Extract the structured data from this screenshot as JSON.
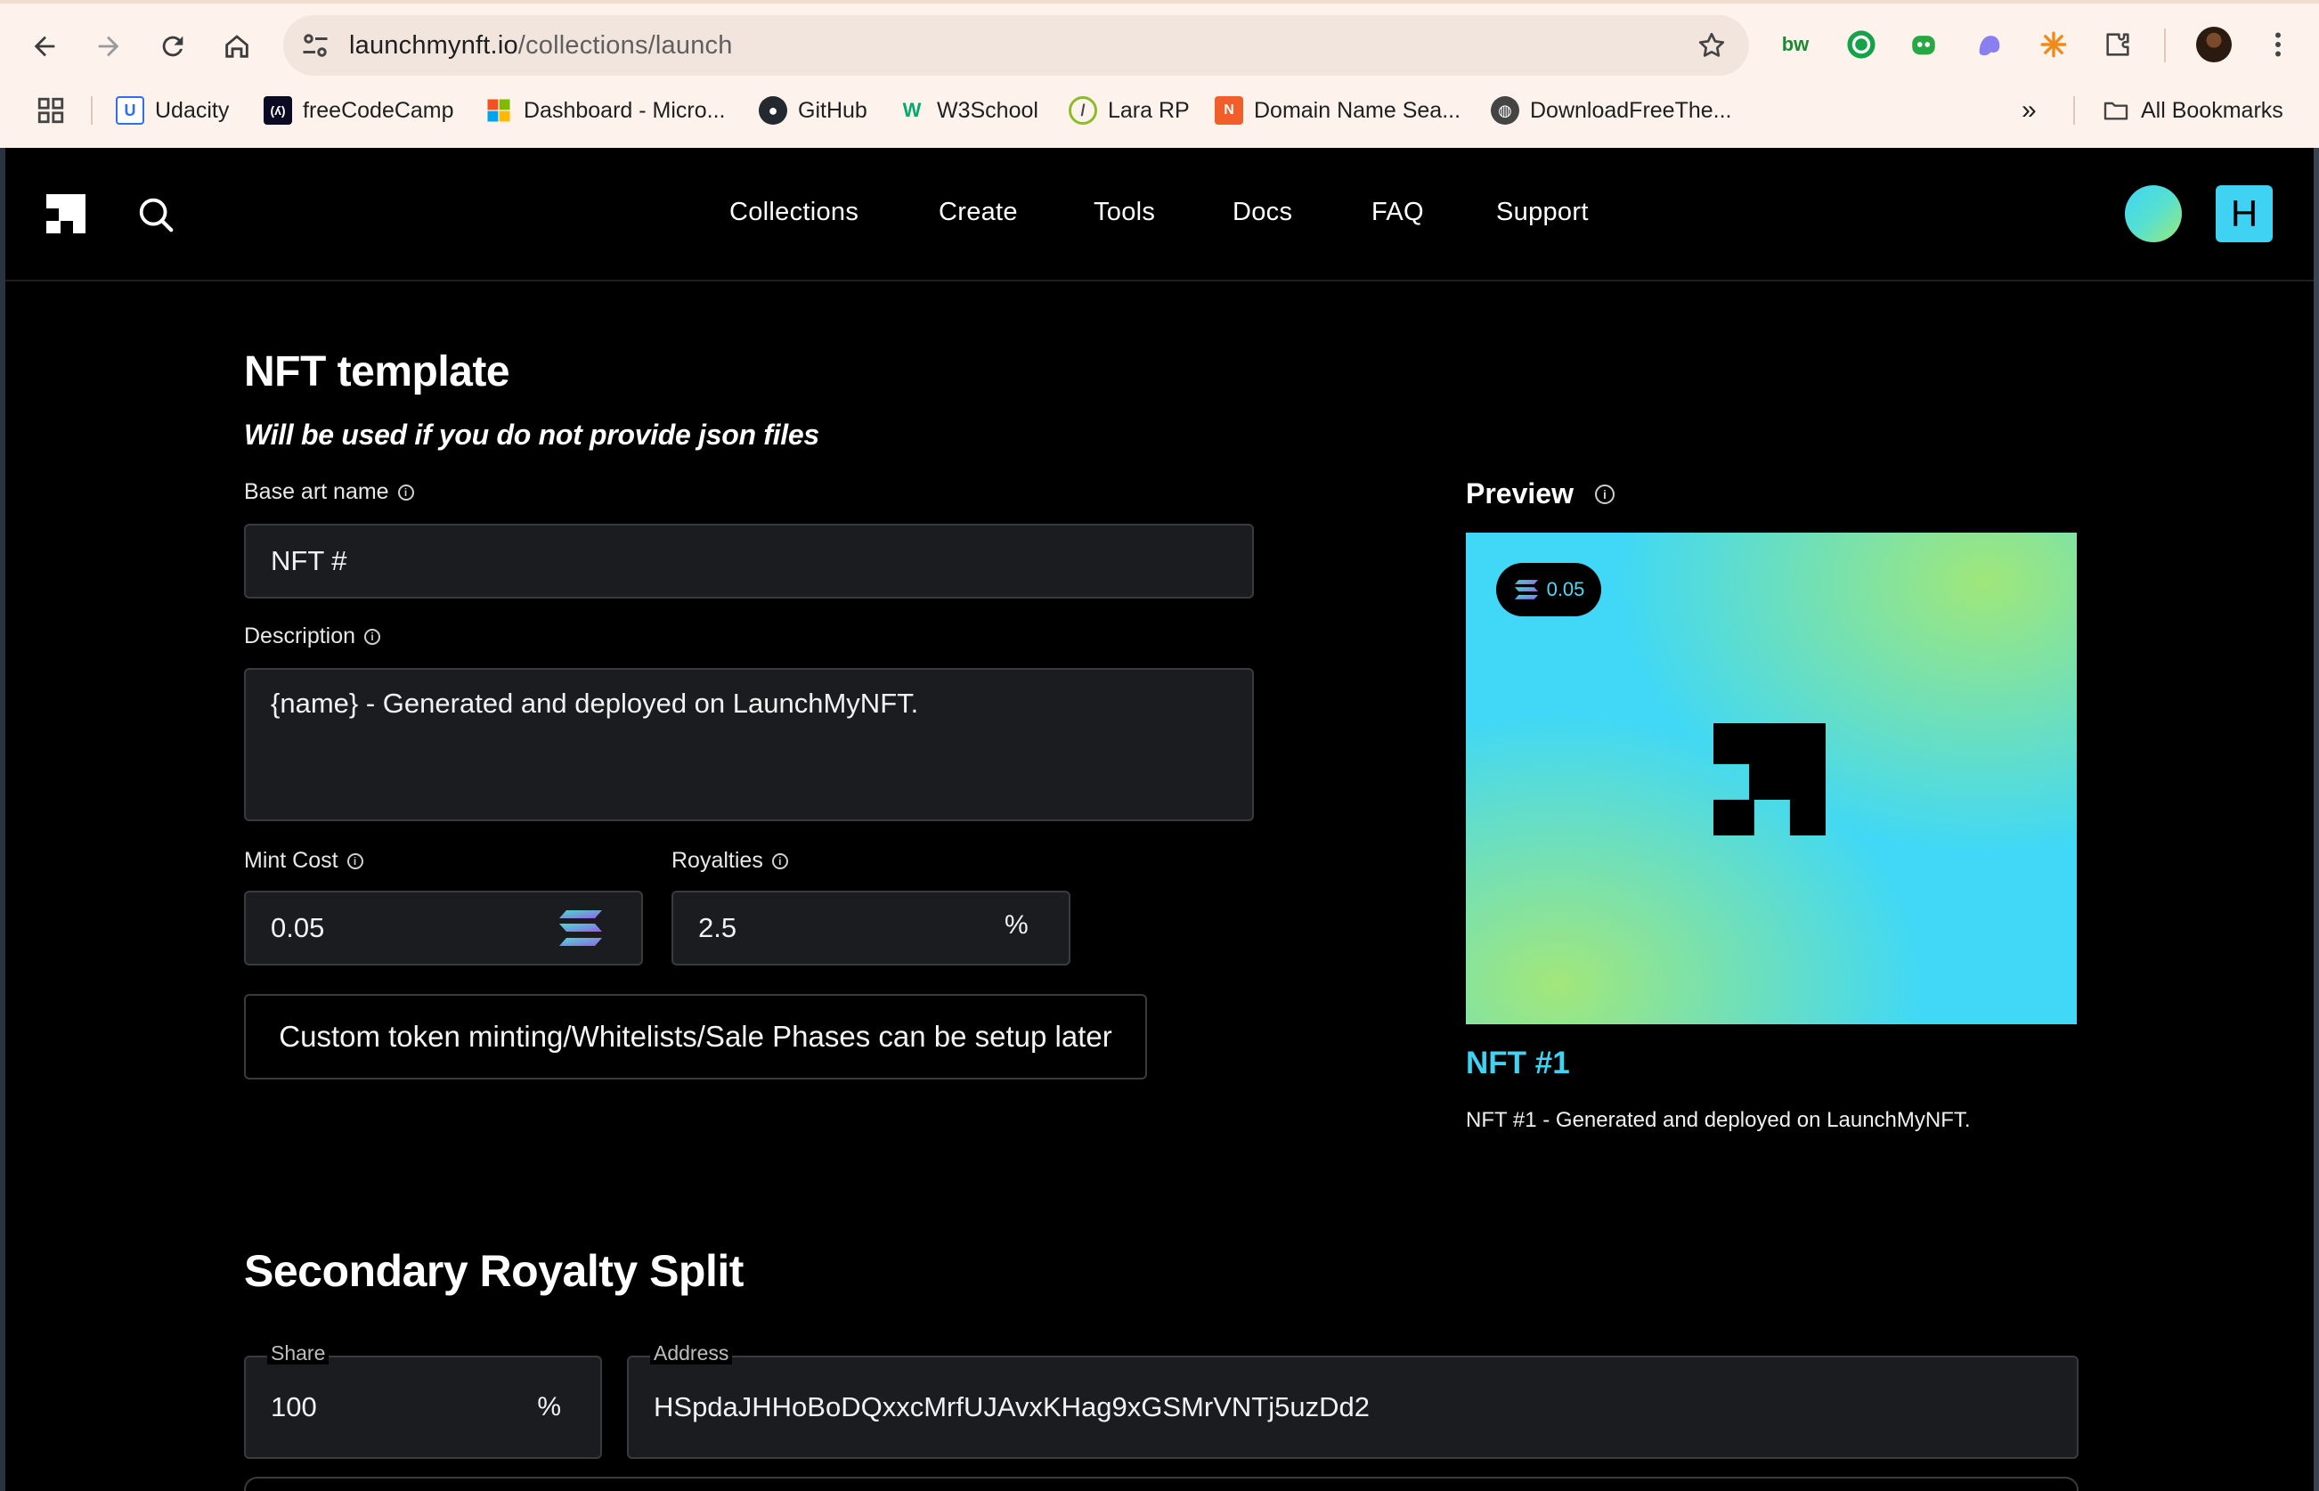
{
  "browser": {
    "url_host": "launchmynft.io",
    "url_path": "/collections/launch",
    "bookmarks": [
      {
        "label": "Udacity",
        "icon": "udacity-icon"
      },
      {
        "label": "freeCodeCamp",
        "icon": "freecodecamp-icon"
      },
      {
        "label": "Dashboard - Micro...",
        "icon": "microsoft-icon"
      },
      {
        "label": "GitHub",
        "icon": "github-icon"
      },
      {
        "label": "W3School",
        "icon": "w3schools-icon"
      },
      {
        "label": "Lara RP",
        "icon": "lara-icon"
      },
      {
        "label": "Domain Name Sea...",
        "icon": "namecheap-icon"
      },
      {
        "label": "DownloadFreeThe...",
        "icon": "globe-icon"
      }
    ],
    "overflow_label": "»",
    "all_bookmarks_label": "All Bookmarks",
    "extensions": [
      {
        "name": "bw-extension-icon",
        "text": "bw",
        "color": "#1a8a2e"
      },
      {
        "name": "grammarly-icon",
        "color": "#15a34a"
      },
      {
        "name": "robot-extension-icon",
        "color": "#27a843"
      },
      {
        "name": "ghost-extension-icon",
        "color": "#8a7ff0"
      },
      {
        "name": "sparkle-extension-icon",
        "color": "#f08a1c"
      },
      {
        "name": "puzzle-extensions-icon",
        "color": "#444444"
      }
    ]
  },
  "site": {
    "nav": [
      "Collections",
      "Create",
      "Tools",
      "Docs",
      "FAQ",
      "Support"
    ],
    "user_initial": "H",
    "accent": "#40d2f2"
  },
  "template": {
    "title": "NFT template",
    "subtitle": "Will be used if you do not provide json files",
    "base_art_name_label": "Base art name",
    "base_art_name_value": "NFT #",
    "description_label": "Description",
    "description_value": "{name} - Generated and deployed on LaunchMyNFT.",
    "mint_cost_label": "Mint Cost",
    "mint_cost_value": "0.05",
    "royalties_label": "Royalties",
    "royalties_value": "2.5",
    "royalties_suffix": "%",
    "note": "Custom token minting/Whitelists/Sale Phases can be setup later"
  },
  "preview": {
    "title": "Preview",
    "price": "0.05",
    "nft_name": "NFT #1",
    "nft_description": "NFT #1 - Generated and deployed on LaunchMyNFT."
  },
  "royalty_split": {
    "title": "Secondary Royalty Split",
    "share_label": "Share",
    "share_value": "100",
    "share_suffix": "%",
    "address_label": "Address",
    "address_value": "HSpdaJHHoBoDQxxcMrfUJAvxKHag9xGSMrVNTj5uzDd2"
  }
}
